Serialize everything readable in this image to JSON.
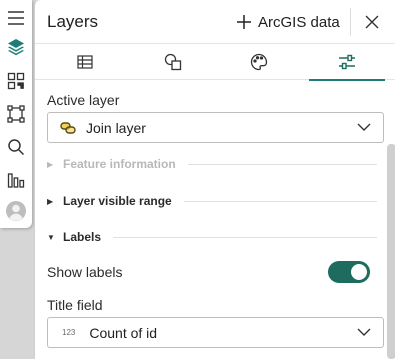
{
  "toolbar": {
    "items": [
      {
        "name": "menu-icon"
      },
      {
        "name": "layers-icon",
        "active": true
      },
      {
        "name": "qr-icon"
      },
      {
        "name": "select-area-icon"
      },
      {
        "name": "search-icon"
      },
      {
        "name": "chart-icon"
      },
      {
        "name": "avatar-icon"
      }
    ]
  },
  "panel": {
    "title": "Layers",
    "add_data_label": "ArcGIS data",
    "tabs": [
      {
        "name": "table-icon"
      },
      {
        "name": "shapes-icon"
      },
      {
        "name": "palette-icon"
      },
      {
        "name": "sliders-icon",
        "active": true
      }
    ],
    "active_layer": {
      "label": "Active layer",
      "value": "Join layer"
    },
    "sections": {
      "feature_information": "Feature information",
      "layer_visible_range": "Layer visible range",
      "labels": "Labels"
    },
    "show_labels": {
      "label": "Show labels",
      "enabled": true
    },
    "title_field": {
      "label": "Title field",
      "type_tag": "123",
      "value": "Count of id"
    }
  },
  "colors": {
    "accent": "#1e7d78",
    "toggle_on": "#1e6b5f",
    "layers_icon": "#1e7d78"
  }
}
